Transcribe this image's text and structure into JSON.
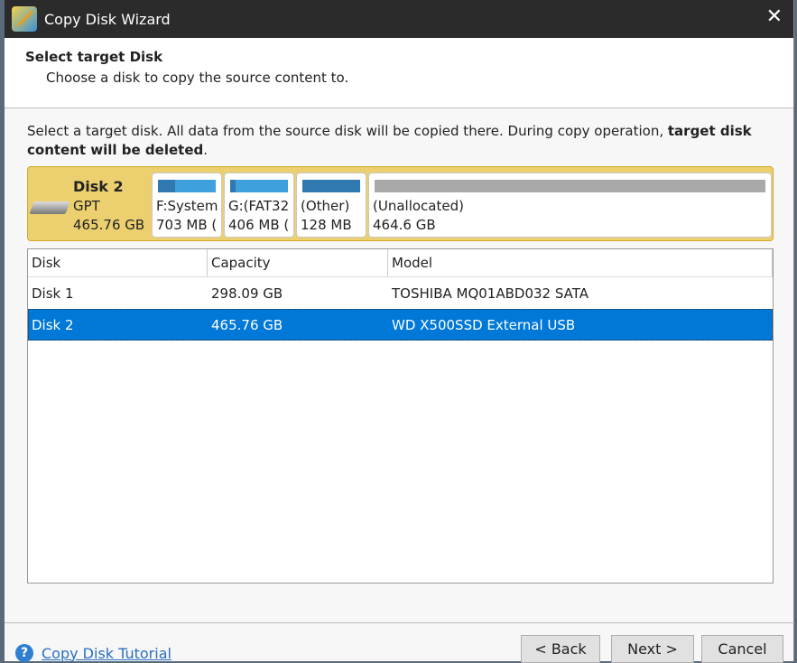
{
  "window": {
    "title": "Copy Disk Wizard",
    "close": "✕"
  },
  "header": {
    "title": "Select target Disk",
    "subtitle": "Choose a disk to copy the source content to."
  },
  "info": {
    "text": "Select a target disk. All data from the source disk will be copied there. During copy operation, ",
    "bold": "target disk content will be deleted",
    "end": "."
  },
  "disk_map": {
    "name": "Disk 2",
    "type": "GPT",
    "size": "465.76 GB",
    "partitions": [
      {
        "label": "F:System",
        "size": "703 MB (",
        "used_fraction": 0.3
      },
      {
        "label": "G:(FAT32",
        "size": "406 MB (",
        "used_fraction": 0.1
      },
      {
        "label": "(Other)",
        "size": "128 MB",
        "used_fraction": 1.0
      },
      {
        "label": "(Unallocated)",
        "size": "464.6 GB",
        "used_fraction": 0
      }
    ]
  },
  "table": {
    "headers": [
      "Disk",
      "Capacity",
      "Model"
    ],
    "rows": [
      {
        "disk": "Disk 1",
        "capacity": "298.09 GB",
        "model": "TOSHIBA MQ01ABD032 SATA"
      },
      {
        "disk": "Disk 2",
        "capacity": "465.76 GB",
        "model": "WD X500SSD External USB"
      }
    ]
  },
  "footer": {
    "tutorial": "Copy Disk Tutorial",
    "help_glyph": "?",
    "back": "< Back",
    "next": "Next >",
    "cancel": "Cancel"
  }
}
